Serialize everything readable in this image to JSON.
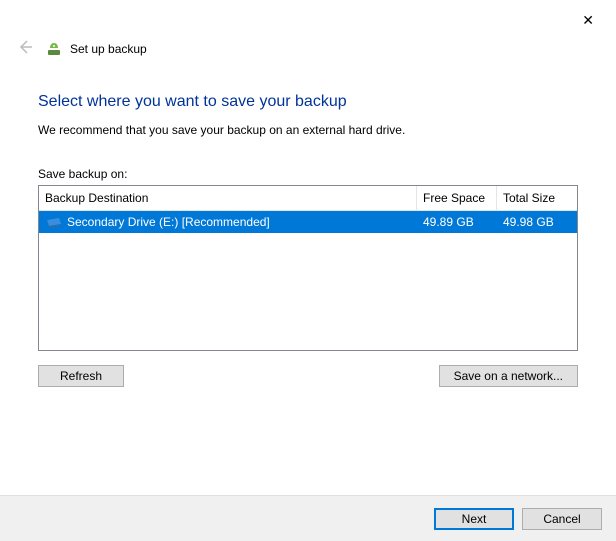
{
  "close": "✕",
  "titlebar": {
    "text": "Set up backup"
  },
  "heading": "Select where you want to save your backup",
  "subtext": "We recommend that you save your backup on an external hard drive.",
  "list_label": "Save backup on:",
  "columns": {
    "destination": "Backup Destination",
    "free": "Free Space",
    "total": "Total Size"
  },
  "rows": [
    {
      "name": "Secondary Drive (E:) [Recommended]",
      "free": "49.89 GB",
      "total": "49.98 GB"
    }
  ],
  "buttons": {
    "refresh": "Refresh",
    "save_network": "Save on a network...",
    "next": "Next",
    "cancel": "Cancel"
  }
}
